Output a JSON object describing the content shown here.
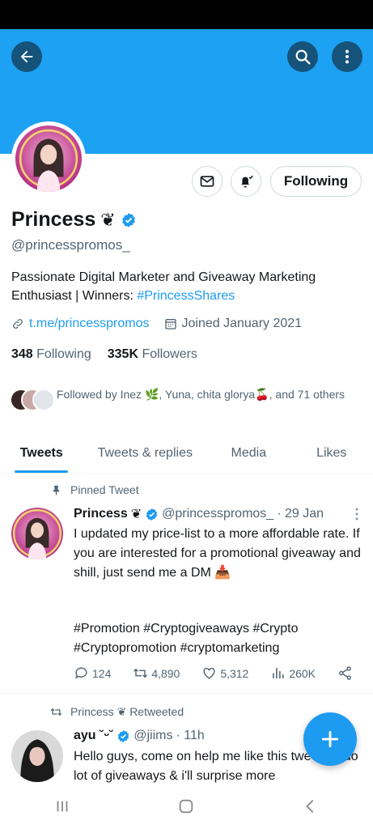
{
  "header": {
    "back_icon": "arrow-left-icon",
    "search_icon": "search-icon",
    "more_icon": "more-vertical-icon",
    "banner_color": "#1da1f2"
  },
  "profile": {
    "name": "Princess",
    "name_emoji": "❦",
    "verified": true,
    "handle": "@princesspromos_",
    "bio_text": "Passionate Digital Marketer and Giveaway Marketing Enthusiast | Winners: ",
    "bio_hashtag": "#PrincessShares",
    "link": "t.me/princesspromos",
    "joined": "Joined January 2021",
    "following_count": "348",
    "following_label": "Following",
    "followers_count": "335K",
    "followers_label": "Followers",
    "followed_by": "Followed by Inez 🌿, Yuna, chita glorya🍒, and 71 others",
    "following_button": "Following"
  },
  "tabs": [
    {
      "label": "Tweets",
      "active": true
    },
    {
      "label": "Tweets & replies",
      "active": false
    },
    {
      "label": "Media",
      "active": false
    },
    {
      "label": "Likes",
      "active": false
    }
  ],
  "pinned_tweet": {
    "context": "Pinned Tweet",
    "name": "Princess",
    "name_emoji": "❦",
    "handle": "@princesspromos_",
    "date": "· 29 Jan",
    "text": "I updated my price-list to a more affordable rate. If you are interested for a promotional giveaway and shill, just send me a DM 📥",
    "hashtags_line1": "#Promotion #Cryptogiveaways #Crypto",
    "hashtags_line2": "#Cryptopromotion #cryptomarketing",
    "replies": "124",
    "retweets": "4,890",
    "likes": "5,312",
    "views": "260K"
  },
  "retweet": {
    "context": "Princess ❦ Retweeted",
    "name": "ayu ˘ᵕ˘",
    "handle": "@jiims",
    "date": "· 11h",
    "text": "Hello guys, come on help me like this tweet, i'll do lot of giveaways & i'll surprise more"
  },
  "colors": {
    "accent": "#1d9bf0",
    "text": "#14171a",
    "secondary": "#536471"
  }
}
